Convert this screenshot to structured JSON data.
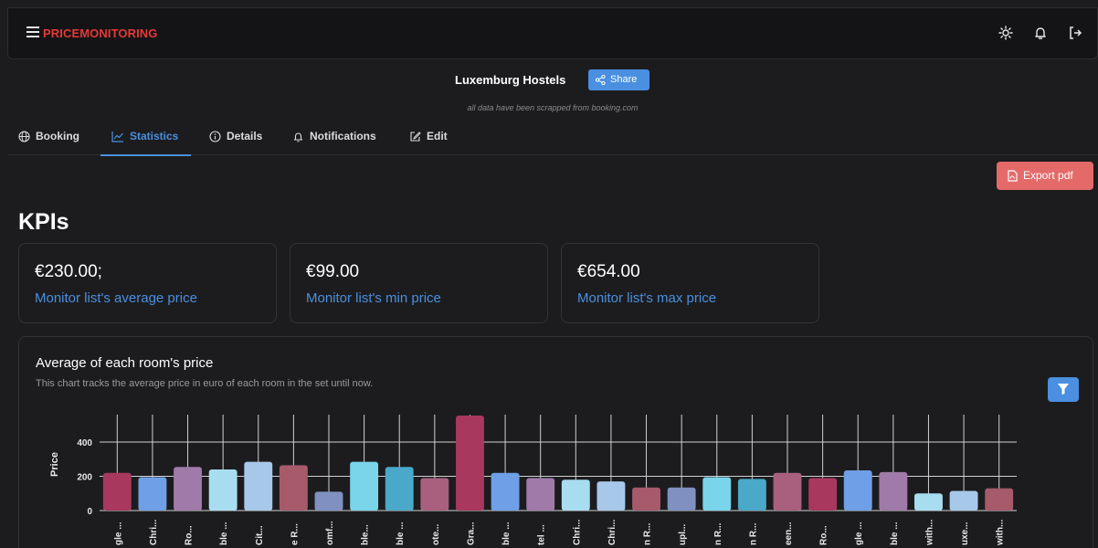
{
  "app": {
    "brand": "PRICEMONITORING"
  },
  "topbar": {
    "icons": [
      "menu-icon",
      "sun-icon",
      "bell-icon",
      "logout-icon"
    ]
  },
  "header": {
    "title": "Luxemburg Hostels",
    "share_label": "Share",
    "note": "all data have been scrapped from booking.com"
  },
  "tabs": [
    {
      "label": "Booking",
      "icon": "globe-icon"
    },
    {
      "label": "Statistics",
      "icon": "chart-line-icon",
      "active": true
    },
    {
      "label": "Details",
      "icon": "info-icon"
    },
    {
      "label": "Notifications",
      "icon": "bell-icon"
    },
    {
      "label": "Edit",
      "icon": "edit-icon"
    }
  ],
  "export_label": "Export pdf",
  "kpis": {
    "title": "KPIs",
    "items": [
      {
        "value": "€230.00;",
        "label": "Monitor list's average price"
      },
      {
        "value": "€99.00",
        "label": "Monitor list's min price"
      },
      {
        "value": "€654.00",
        "label": "Monitor list's max price"
      }
    ]
  },
  "chart": {
    "title": "Average of each room's price",
    "subtitle": "This chart tracks the average price in euro of each room in the set until now."
  },
  "colors": {
    "accent": "#4a8fe0",
    "brand": "#e53935",
    "export": "#e46a6a"
  },
  "chart_data": {
    "type": "bar",
    "ylabel": "Price",
    "yticks": [
      0,
      200,
      400
    ],
    "ylim": [
      0,
      560
    ],
    "grid": true,
    "categories": [
      "gle ...",
      "Chri...",
      "Ro...",
      "ble ...",
      "Cit...",
      "e R...",
      "omf...",
      "ble...",
      "ble ...",
      "ote...",
      "Gra...",
      "ble ...",
      "tel ...",
      "Chri...",
      "Chri...",
      "n R...",
      "upl...",
      "n R...",
      "n R...",
      "een...",
      "Ro...",
      "gle ...",
      "ble ...",
      "with...",
      "uxe...",
      "with..."
    ],
    "values": [
      220,
      195,
      255,
      240,
      285,
      265,
      110,
      285,
      255,
      190,
      555,
      220,
      190,
      180,
      170,
      135,
      135,
      195,
      185,
      220,
      190,
      235,
      225,
      100,
      115,
      130
    ],
    "colors": [
      "#a8385e",
      "#6f9fe6",
      "#a07aa8",
      "#a8ddf0",
      "#a8c8ea",
      "#a65a6a",
      "#8090c0",
      "#7ad4ea",
      "#4aa8c8",
      "#a8607e",
      "#a8385e",
      "#6f9fe6",
      "#a07aa8",
      "#a8ddf0",
      "#a8c8ea",
      "#a65a6a",
      "#8090c0",
      "#7ad4ea",
      "#4aa8c8",
      "#a8607e",
      "#a8385e",
      "#6f9fe6",
      "#a07aa8",
      "#a8ddf0",
      "#a8c8ea",
      "#a65a6a"
    ]
  }
}
